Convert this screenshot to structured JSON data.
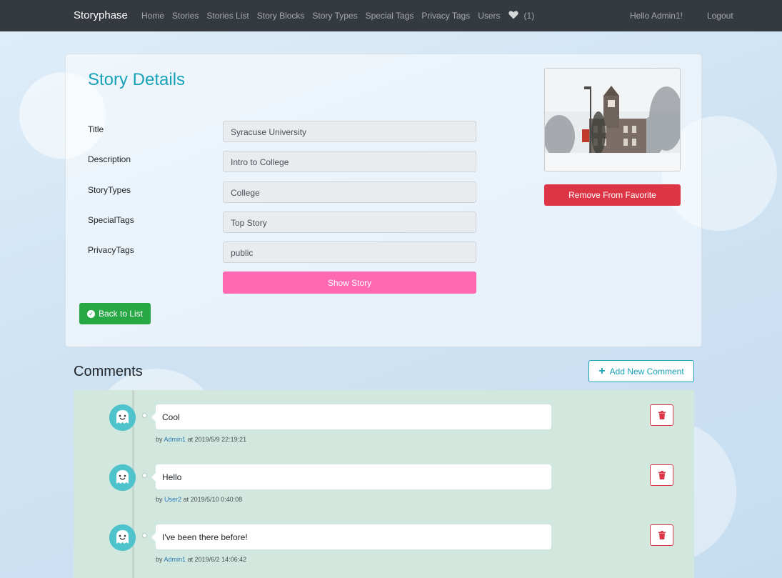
{
  "navbar": {
    "brand": "Storyphase",
    "links": [
      "Home",
      "Stories",
      "Stories List",
      "Story Blocks",
      "Story Types",
      "Special Tags",
      "Privacy Tags",
      "Users"
    ],
    "favorites_count": "(1)",
    "greeting": "Hello Admin1!",
    "logout": "Logout"
  },
  "details": {
    "title": "Story Details",
    "fields": [
      {
        "label": "Title",
        "value": "Syracuse University"
      },
      {
        "label": "Description",
        "value": "Intro to College"
      },
      {
        "label": "StoryTypes",
        "value": "College"
      },
      {
        "label": "SpecialTags",
        "value": "Top Story"
      },
      {
        "label": "PrivacyTags",
        "value": "public"
      }
    ],
    "show_story": "Show Story",
    "back_to_list": "Back to List",
    "remove_favorite": "Remove From Favorite"
  },
  "comments": {
    "title": "Comments",
    "add_label": "Add New Comment",
    "items": [
      {
        "text": "Cool",
        "by": "by",
        "author": "Admin1",
        "at": "at 2019/5/9 22:19:21"
      },
      {
        "text": "Hello",
        "by": "by",
        "author": "User2",
        "at": "at 2019/5/10 0:40:08"
      },
      {
        "text": "I've been there before!",
        "by": "by",
        "author": "Admin1",
        "at": "at 2019/6/2 14:06:42"
      }
    ]
  },
  "colors": {
    "navbar": "#343a40",
    "accent": "#17a2b8",
    "pink": "#ff69b4",
    "success": "#28a745",
    "danger": "#dc3545",
    "comments_bg": "#d2e7de"
  }
}
